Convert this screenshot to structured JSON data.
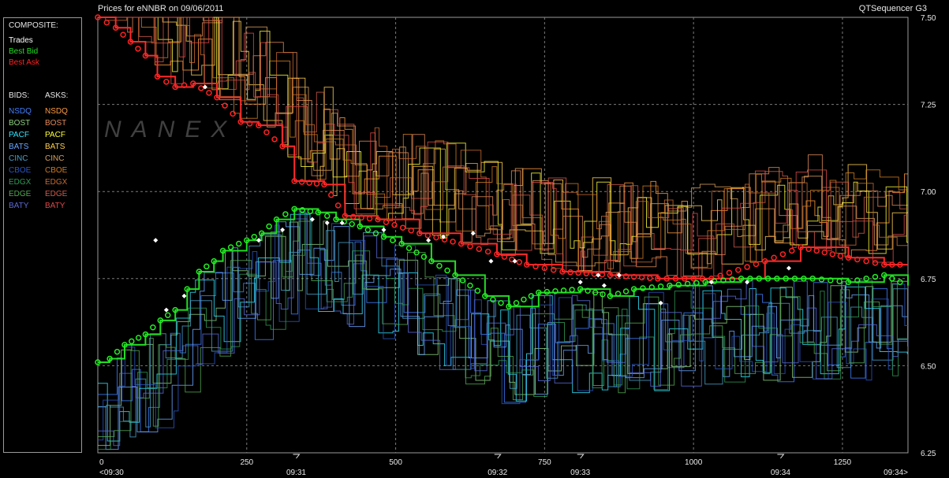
{
  "header": {
    "title": "Prices for  eNNBR  on  09/06/2011",
    "app_name": "QTSequencer G3"
  },
  "legend": {
    "composite_heading": "COMPOSITE:",
    "composite": [
      {
        "label": "Trades",
        "color": "#ffffff"
      },
      {
        "label": "Best Bid",
        "color": "#22dd22"
      },
      {
        "label": "Best Ask",
        "color": "#ff2222"
      }
    ],
    "bids_heading": "BIDS:",
    "asks_heading": "ASKS:",
    "bids": [
      {
        "label": "NSDQ",
        "color": "#3f7fff"
      },
      {
        "label": "BOST",
        "color": "#8fd080"
      },
      {
        "label": "PACF",
        "color": "#33e6ff"
      },
      {
        "label": "BATS",
        "color": "#6aa6ff"
      },
      {
        "label": "CINC",
        "color": "#4aa0c8"
      },
      {
        "label": "CBOE",
        "color": "#2a55c0"
      },
      {
        "label": "EDGX",
        "color": "#2f9a55"
      },
      {
        "label": "EDGE",
        "color": "#52a852"
      },
      {
        "label": "BATY",
        "color": "#5a6ad8"
      }
    ],
    "asks": [
      {
        "label": "NSDQ",
        "color": "#ff9a3c"
      },
      {
        "label": "BOST",
        "color": "#e08a5a"
      },
      {
        "label": "PACF",
        "color": "#ffff3a"
      },
      {
        "label": "BATS",
        "color": "#ffd050"
      },
      {
        "label": "CINC",
        "color": "#d8a060"
      },
      {
        "label": "CBOE",
        "color": "#d07a20"
      },
      {
        "label": "EDGX",
        "color": "#c86a30"
      },
      {
        "label": "EDGE",
        "color": "#d25a4a"
      },
      {
        "label": "BATY",
        "color": "#e04848"
      }
    ]
  },
  "watermark": "NANEX",
  "chart_data": {
    "type": "line",
    "xlim": [
      0,
      1360
    ],
    "ylim": [
      6.25,
      7.5
    ],
    "y_ticks": [
      "7.50",
      "7.25",
      "7.00",
      "6.75",
      "6.50",
      "6.25"
    ],
    "x_ticks": [
      "0",
      "250",
      "500",
      "750",
      "1000",
      "1250"
    ],
    "time_labels": [
      {
        "x": 0,
        "label": "<09:30"
      },
      {
        "x": 333,
        "label": "09:31"
      },
      {
        "x": 671,
        "label": "09:32"
      },
      {
        "x": 810,
        "label": "09:33"
      },
      {
        "x": 1146,
        "label": "09:34"
      },
      {
        "x": 1360,
        "label": "09:34>"
      }
    ],
    "grid": true,
    "best_ask": [
      [
        0,
        7.5
      ],
      [
        30,
        7.47
      ],
      [
        55,
        7.43
      ],
      [
        80,
        7.39
      ],
      [
        100,
        7.33
      ],
      [
        130,
        7.3
      ],
      [
        160,
        7.31
      ],
      [
        200,
        7.27
      ],
      [
        240,
        7.2
      ],
      [
        270,
        7.19
      ],
      [
        310,
        7.13
      ],
      [
        330,
        7.03
      ],
      [
        380,
        7.02
      ],
      [
        415,
        6.93
      ],
      [
        470,
        6.92
      ],
      [
        540,
        6.88
      ],
      [
        610,
        6.85
      ],
      [
        670,
        6.82
      ],
      [
        720,
        6.79
      ],
      [
        780,
        6.77
      ],
      [
        860,
        6.76
      ],
      [
        940,
        6.75
      ],
      [
        1030,
        6.75
      ],
      [
        1120,
        6.8
      ],
      [
        1180,
        6.84
      ],
      [
        1260,
        6.81
      ],
      [
        1320,
        6.79
      ],
      [
        1360,
        6.79
      ]
    ],
    "best_bid": [
      [
        0,
        6.51
      ],
      [
        20,
        6.52
      ],
      [
        45,
        6.56
      ],
      [
        80,
        6.59
      ],
      [
        105,
        6.63
      ],
      [
        130,
        6.66
      ],
      [
        150,
        6.72
      ],
      [
        170,
        6.77
      ],
      [
        195,
        6.8
      ],
      [
        210,
        6.83
      ],
      [
        250,
        6.86
      ],
      [
        275,
        6.88
      ],
      [
        300,
        6.92
      ],
      [
        330,
        6.95
      ],
      [
        370,
        6.94
      ],
      [
        400,
        6.92
      ],
      [
        440,
        6.9
      ],
      [
        480,
        6.87
      ],
      [
        510,
        6.85
      ],
      [
        560,
        6.8
      ],
      [
        600,
        6.76
      ],
      [
        650,
        6.7
      ],
      [
        690,
        6.67
      ],
      [
        740,
        6.71
      ],
      [
        810,
        6.72
      ],
      [
        860,
        6.7
      ],
      [
        900,
        6.72
      ],
      [
        960,
        6.73
      ],
      [
        1020,
        6.74
      ],
      [
        1080,
        6.75
      ],
      [
        1140,
        6.75
      ],
      [
        1200,
        6.75
      ],
      [
        1260,
        6.74
      ],
      [
        1320,
        6.76
      ],
      [
        1360,
        6.73
      ]
    ],
    "trades": [
      [
        97,
        6.86
      ],
      [
        115,
        6.66
      ],
      [
        145,
        6.7
      ],
      [
        180,
        7.3
      ],
      [
        270,
        6.86
      ],
      [
        310,
        6.89
      ],
      [
        360,
        6.92
      ],
      [
        385,
        6.91
      ],
      [
        410,
        6.91
      ],
      [
        480,
        6.89
      ],
      [
        555,
        6.86
      ],
      [
        580,
        6.87
      ],
      [
        630,
        6.88
      ],
      [
        660,
        6.8
      ],
      [
        700,
        6.8
      ],
      [
        810,
        6.74
      ],
      [
        840,
        6.76
      ],
      [
        850,
        6.73
      ],
      [
        875,
        6.76
      ],
      [
        945,
        6.68
      ],
      [
        1030,
        6.74
      ],
      [
        1090,
        6.74
      ],
      [
        1160,
        6.78
      ]
    ]
  }
}
